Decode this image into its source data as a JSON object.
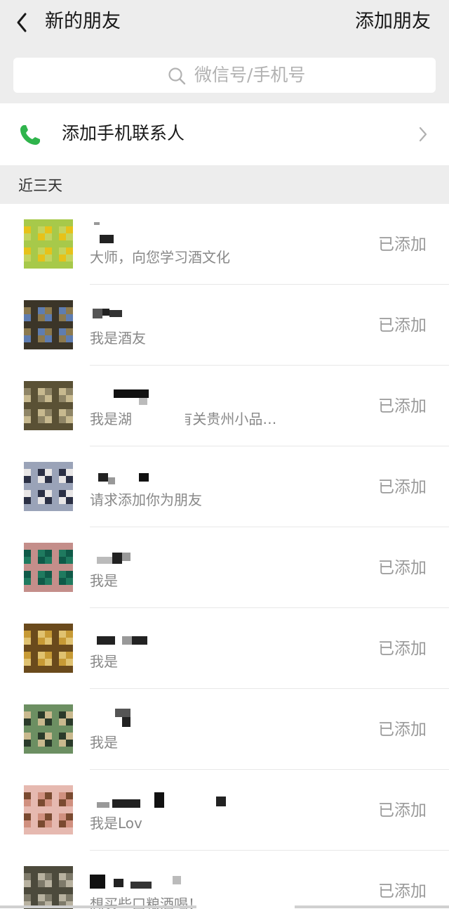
{
  "header": {
    "title": "新的朋友",
    "action_label": "添加朋友"
  },
  "search": {
    "placeholder": "微信号/手机号"
  },
  "phone_contacts": {
    "label": "添加手机联系人"
  },
  "section": {
    "label": "近三天"
  },
  "requests": [
    {
      "message": "大师，向您学习酒文化",
      "status": "已添加",
      "avatar_colors": [
        "#a7c94a",
        "#c4d45e",
        "#e6c21a"
      ]
    },
    {
      "message": "我是酒友",
      "status": "已添加",
      "avatar_colors": [
        "#5f7db0",
        "#8c7a4f",
        "#3b3528"
      ]
    },
    {
      "message": "我是湖       要咨询有关贵州小品…",
      "status": "已添加",
      "avatar_colors": [
        "#8f8566",
        "#5a5135",
        "#c7b98f"
      ]
    },
    {
      "message": "请求添加你为朋友",
      "status": "已添加",
      "avatar_colors": [
        "#9aa3b8",
        "#2b3045",
        "#e8e6e6"
      ]
    },
    {
      "message": "我是",
      "status": "已添加",
      "avatar_colors": [
        "#1f7a5f",
        "#0f5a48",
        "#c48e8a"
      ]
    },
    {
      "message": "我是",
      "status": "已添加",
      "avatar_colors": [
        "#c79a35",
        "#6a4a1c",
        "#e0c270"
      ]
    },
    {
      "message": "我是",
      "status": "已添加",
      "avatar_colors": [
        "#6c8f62",
        "#2a3a2a",
        "#c9b98e"
      ]
    },
    {
      "message": "我是Lov",
      "status": "已添加",
      "avatar_colors": [
        "#d0907f",
        "#7a4a30",
        "#e6b9b0"
      ]
    },
    {
      "message": "想买些口粮酒喝！",
      "status": "已添加",
      "avatar_colors": [
        "#7e7a6a",
        "#4c4a3c",
        "#b8b2a0"
      ]
    }
  ],
  "colors": {
    "background": "#ededed",
    "surface": "#ffffff",
    "phone_icon": "#2fb44c",
    "muted_text": "#888888"
  }
}
